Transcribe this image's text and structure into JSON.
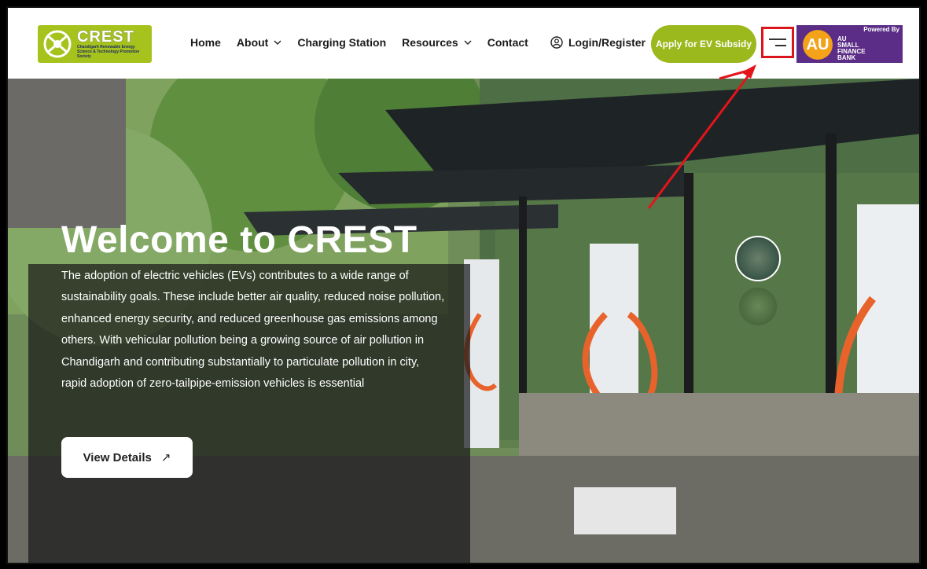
{
  "logo": {
    "title": "CREST",
    "subtitle": "Chandigarh Renewable Energy Science & Technology Promotion Society"
  },
  "nav": {
    "items": [
      {
        "label": "Home",
        "has_dropdown": false
      },
      {
        "label": "About",
        "has_dropdown": true
      },
      {
        "label": "Charging Station",
        "has_dropdown": false
      },
      {
        "label": "Resources",
        "has_dropdown": true
      },
      {
        "label": "Contact",
        "has_dropdown": false
      }
    ],
    "login_label": "Login/Register",
    "apply_label": "Apply for EV Subsidy"
  },
  "sponsor": {
    "powered_by": "Powered By",
    "logo_text": "AU",
    "name_lines": [
      "AU",
      "SMALL",
      "FINANCE",
      "BANK"
    ]
  },
  "hero": {
    "title": "Welcome to CREST",
    "description": "The adoption of electric vehicles (EVs) contributes to a wide range of sustainability goals. These include better air quality, reduced noise pollution, enhanced energy security, and reduced greenhouse gas emissions among others. With vehicular pollution being a growing source of air pollution in Chandigarh and contributing substantially to particulate pollution in city, rapid adoption of zero-tailpipe-emission vehicles is essential",
    "cta_label": "View Details",
    "cta_icon": "↗"
  },
  "colors": {
    "brand_green": "#9bb81d",
    "au_purple": "#5b2d86",
    "au_orange": "#f3a21a",
    "highlight_red": "#d8161b"
  }
}
